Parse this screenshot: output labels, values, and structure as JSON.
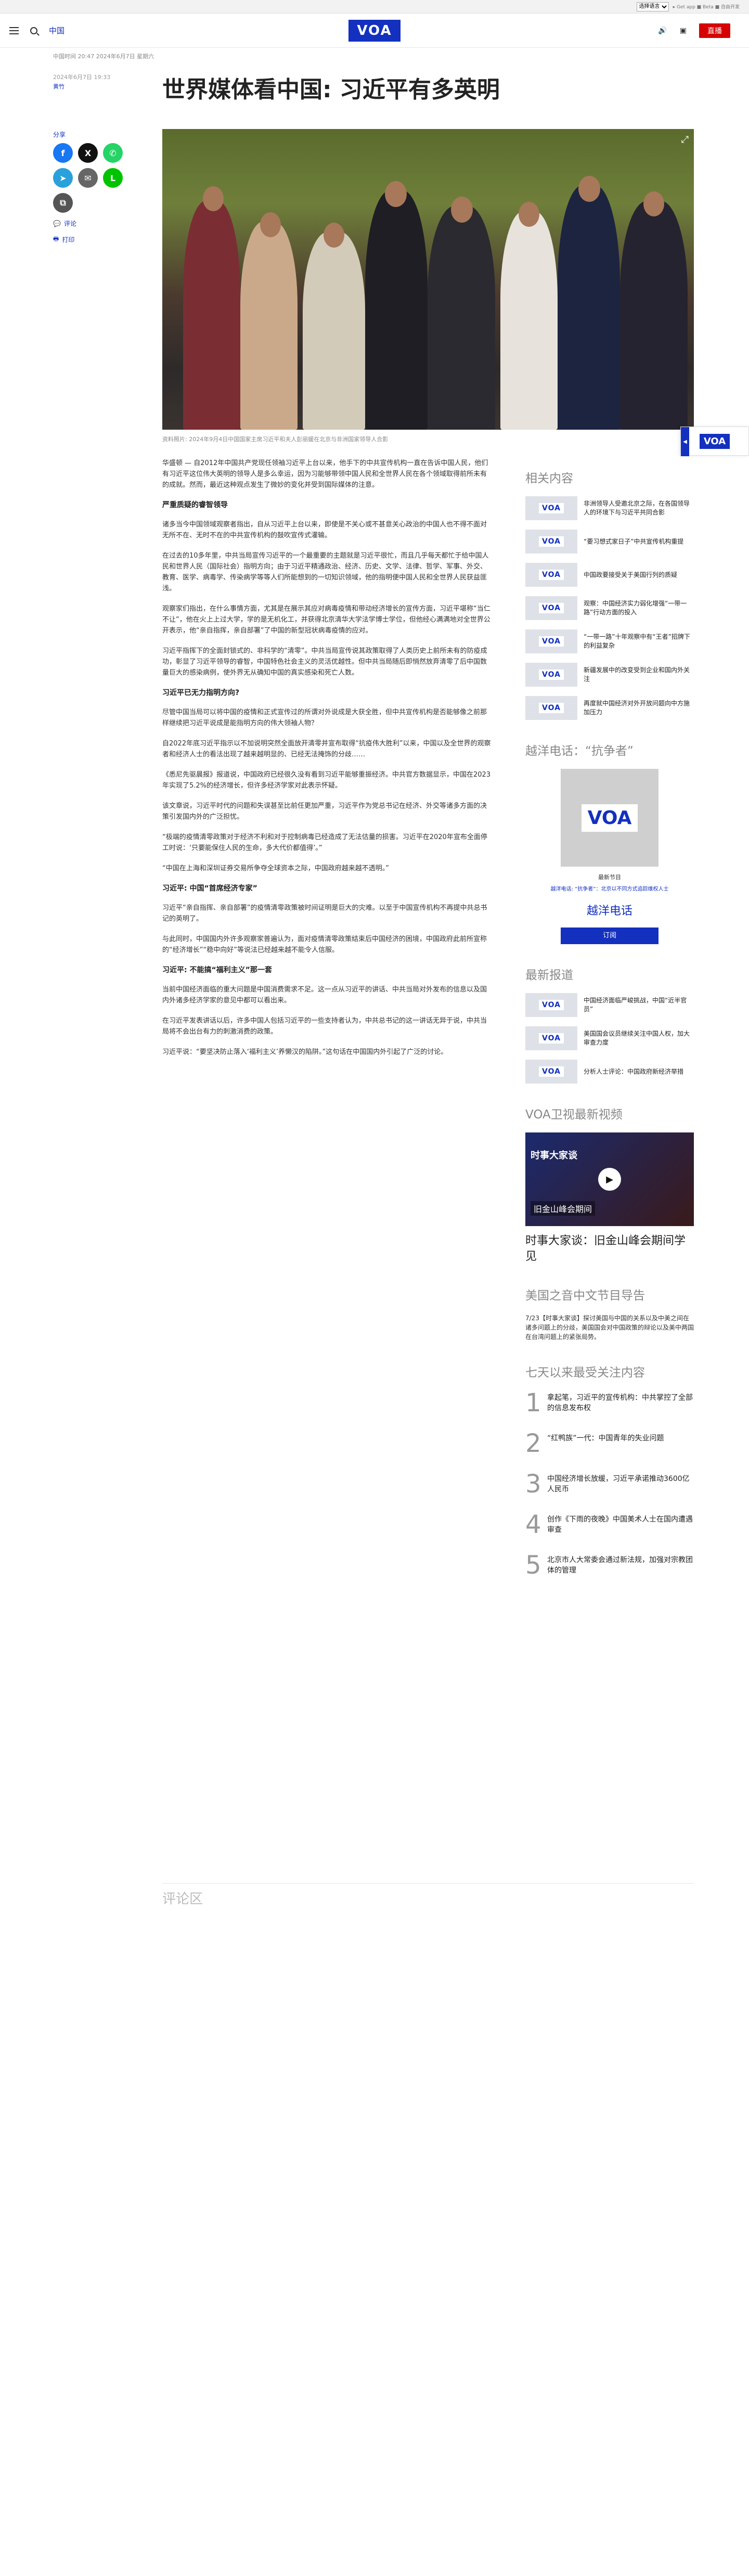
{
  "util": {
    "language_select": "选择语言",
    "links": "▸ Get app  ■ Beta  ■ 自由开发"
  },
  "header": {
    "nav_label": "中国",
    "logo": "VOA",
    "live_label": "直播"
  },
  "article": {
    "meta_line": "中国时间 20:47 2024年6月7日 星期六",
    "date": "2024年6月7日 19:33",
    "author": "黄竹",
    "title": "世界媒体看中国: 习近平有多英明",
    "share_label": "分享",
    "comments_link": "评论",
    "print_link": "打印",
    "caption": "资料照片: 2024年9月4日中国国家主席习近平和夫人彭丽媛在北京与非洲国家领导人合影",
    "paragraphs": [
      "华盛顿 — 自2012年中国共产党现任领袖习近平上台以来，他手下的中共宣传机构一直在告诉中国人民，他们有习近平这位伟大英明的领导人是多么幸运，因为习能够带领中国人民和全世界人民在各个领域取得前所未有的成就。然而，最近这种观点发生了微妙的变化并受到国际媒体的注意。",
      "严重质疑的睿智领导",
      "诸多当今中国领域观察者指出，自从习近平上台以来，即使是不关心或不甚意关心政治的中国人也不得不面对无所不在、无时不在的中共宣传机构的鼓吹宣传式灌输。",
      "在过去的10多年里，中共当局宣传习近平的一个最重要的主题就是习近平很忙，而且几乎每天都忙于给中国人民和世界人民（国际社会）指明方向；由于习近平精通政治、经济、历史、文学、法律、哲学、军事、外交、教育、医学、病毒学、传染病学等等人们所能想到的一切知识领域，他的指明便中国人民和全世界人民获益匪浅。",
      "观察家们指出，在什么事情方面，尤其是在展示其应对病毒疫情和带动经济增长的宣传方面，习近平堪称“当仁不让”，他在火上上过大学，学的是无机化工，并获得北京清华大学法学博士学位，但他经心满满地对全世界公开表示，他“亲自指挥，亲自部署”了中国的新型冠状病毒疫情的应对。",
      "习近平指挥下的全面封锁式的、非科学的“清零”。中共当局宣传说其政策取得了人类历史上前所未有的防疫成功，彰显了习近平领导的睿智，中国特色社会主义的灵活优越性。但中共当局随后即悄然放弃清零了后中国数量巨大的感染病例，使外界无从确知中国的真实感染和死亡人数。",
      "习近平已无力指明方向?",
      "尽管中国当局可以将中国的疫情和正式宣传过的所谓对外说成是大获全胜，但中共宣传机构是否能够像之前那样继续把习近平说成是能指明方向的伟大领袖人物？",
      "自2022年底习近平指示以不加说明突然全面放开清零并宣布取得“抗疫伟大胜利”以来，中国以及全世界的观察者和经济人士的看法出现了越来越明显的、已经无法掩饰的分歧……"
    ],
    "paragraphs2": [
      "《悉尼先驱晨报》报道说，中国政府已经很久没有看到习近平能够重振经济。中共官方数据显示，中国在2023年实现了5.2%的经济增长，但许多经济学家对此表示怀疑。",
      "该文章说，习近平时代的问题和失误甚至比前任更加严重，习近平作为党总书记在经济、外交等诸多方面的决策引发国内外的广泛担忧。",
      "“极端的疫情清零政策对于经济不利和对于控制病毒已经造成了无法估量的损害。习近平在2020年宣布全面停工时说：‘只要能保住人民的生命，多大代价都值得’。”",
      "“中国在上海和深圳证券交易所争夺全球资本之际，中国政府越来越不透明。”",
      "习近平: 中国“首席经济专家”",
      "习近平“亲自指挥、亲自部署”的疫情清零政策被时间证明是巨大的灾难。以至于中国宣传机构不再提中共总书记的英明了。",
      "与此同时，中国国内外许多观察家普遍认为，面对疫情清零政策结束后中国经济的困境，中国政府此前所宣称的“经济增长”“稳中向好”等说法已经越来越不能令人信服。",
      "习近平: 不能搞“福利主义”那一套",
      "当前中国经济面临的重大问题是中国消费需求不足。这一点从习近平的讲话、中共当局对外发布的信息以及国内外诸多经济学家的意见中都可以看出来。",
      "在习近平发表讲话以后，许多中国人包括习近平的一些支持者认为，中共总书记的这一讲话无异于说，中共当局将不会出台有力的刺激消费的政策。",
      "习近平说：“要坚决防止落入‘福利主义’养懒汉的陷阱。”这句话在中国国内外引起了广泛的讨论。"
    ],
    "comments_title": "评论区"
  },
  "sidebar": {
    "related_heading": "相关内容",
    "related": [
      "非洲领导人受邀北京之际，在各国领导人的环境下与习近平共同合影",
      "“要习想式家日子”中共宣传机构重提",
      "中国政要接受关于美国行列的质疑",
      "观察：中国经济实力弱化增强“一带一路”行动方面的投入",
      "“一带一路”十年观察中有“王者”招牌下的利益复杂",
      "新疆发展中的改变受到企业和国内外关注",
      "再度就中国经济对外开放问题向中方施加压力"
    ],
    "podcast_heading": "越洋电话：“抗争者”",
    "podcast_small": "最新节目",
    "podcast_sub": "越洋电话: “抗争者”：北京以不同方式追踪维权人士",
    "podcast_name": "越洋电话",
    "subscribe": "订阅",
    "latest_heading": "最新报道",
    "latest": [
      "中国经济面临严峻挑战，中国“近半官员”",
      "美国国会议员继续关注中国人权，加大审查力度",
      "分析人士评论：中国政府新经济举措"
    ],
    "video_heading": "VOA卫视最新视频",
    "video_label": "时事大家谈",
    "video_bottom": "旧金山峰会期间",
    "video_title": "时事大家谈：旧金山峰会期间学见",
    "program_heading": "美国之音中文节目导告",
    "program_desc": "7/23【时事大家谈】探讨美国与中国的关系以及中美之间在诸多问题上的分歧，美国国会对中国政策的辩论以及美中两国在台湾问题上的紧张局势。",
    "popular_heading": "七天以来最受关注内容",
    "popular": [
      {
        "num": "1",
        "text": "拿起笔，习近平的宣传机构：中共掌控了全部的信息发布权"
      },
      {
        "num": "2",
        "text": "“红鸭族”一代：中国青年的失业问题"
      },
      {
        "num": "3",
        "text": "中国经济增长放缓，习近平承诺推动3600亿人民币"
      },
      {
        "num": "4",
        "text": "创作《下雨的夜晚》中国美术人士在国内遭遇审查"
      },
      {
        "num": "5",
        "text": "北京市人大常委会通过新法规，加强对宗教团体的管理"
      }
    ]
  }
}
